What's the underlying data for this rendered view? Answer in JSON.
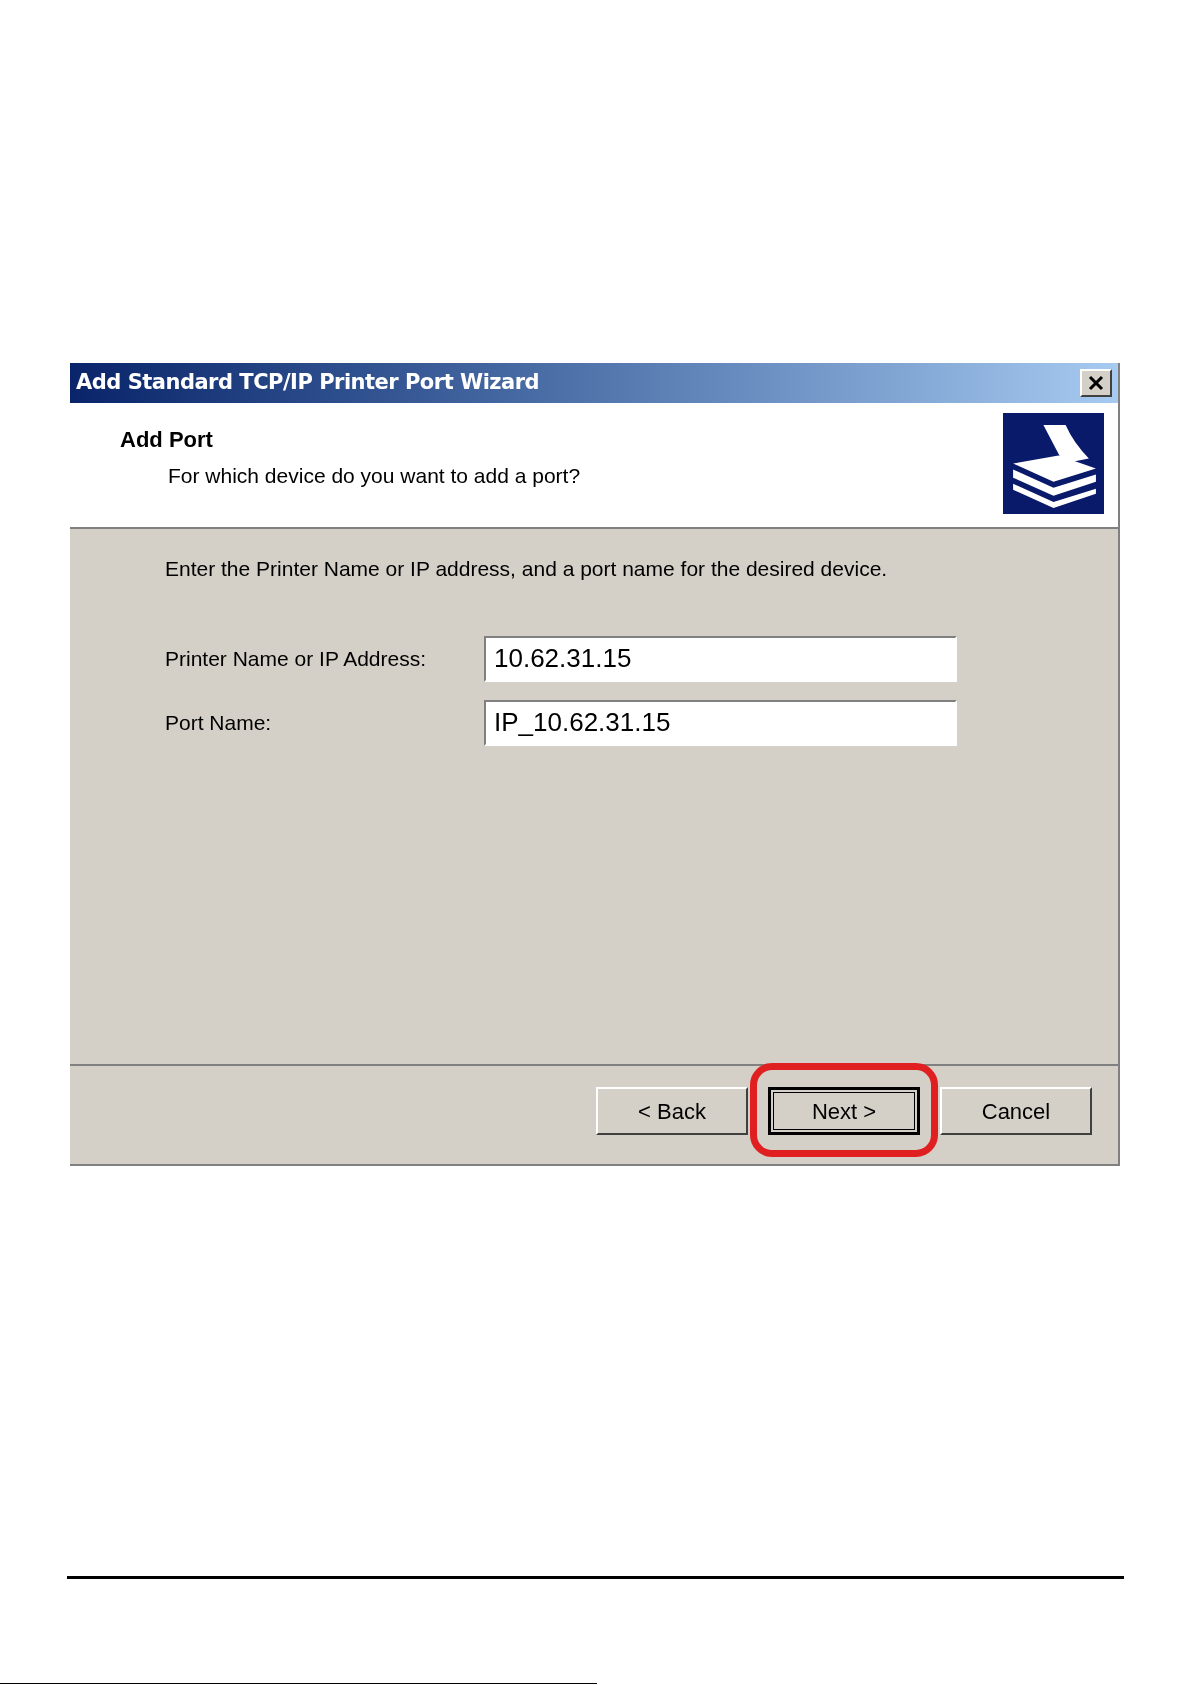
{
  "window": {
    "title": "Add Standard TCP/IP Printer Port Wizard"
  },
  "header": {
    "title": "Add Port",
    "subtitle": "For which device do you want to add a port?"
  },
  "instruction": "Enter the Printer Name or IP address, and a port name for the desired device.",
  "fields": [
    {
      "label": "Printer Name or IP Address:",
      "value": "10.62.31.15"
    },
    {
      "label": "Port Name:",
      "value": "IP_10.62.31.15"
    }
  ],
  "buttons": [
    {
      "label": "< Back",
      "default": false,
      "highlighted": false
    },
    {
      "label": "Next >",
      "default": true,
      "highlighted": true
    },
    {
      "label": "Cancel",
      "default": false,
      "highlighted": false
    }
  ]
}
